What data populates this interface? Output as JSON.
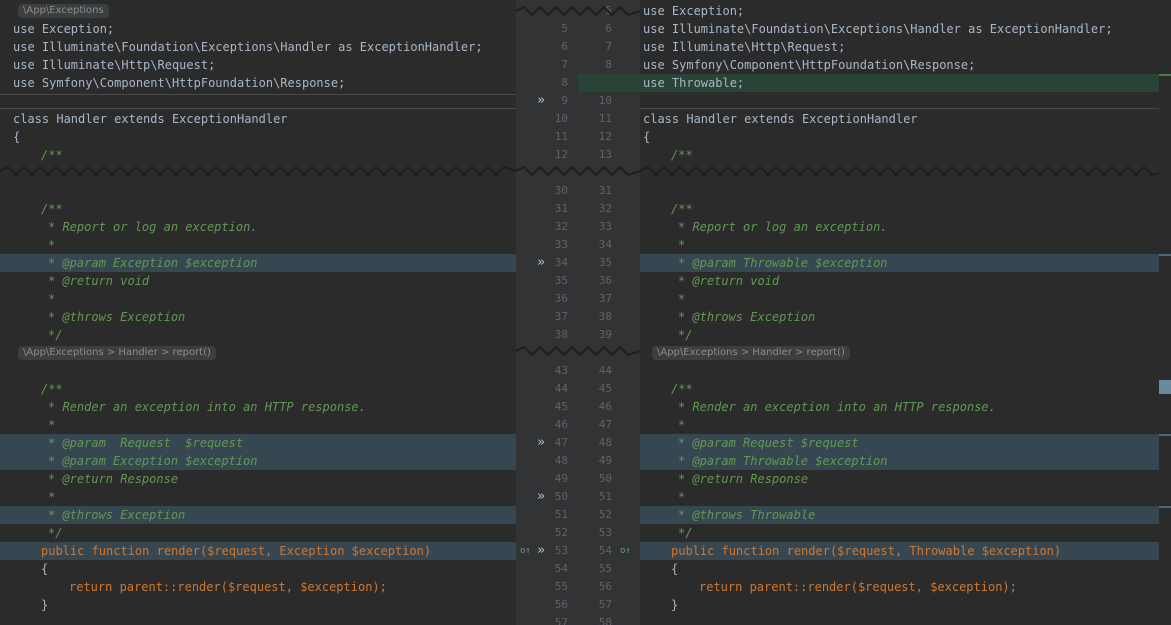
{
  "left": {
    "breadcrumb_top": "\\App\\Exceptions",
    "breadcrumb_mid": "\\App\\Exceptions > Handler > report()",
    "lines": {
      "use1": "use Exception;",
      "use2": "use Illuminate\\Foundation\\Exceptions\\Handler as ExceptionHandler;",
      "use3": "use Illuminate\\Http\\Request;",
      "use4": "use Symfony\\Component\\HttpFoundation\\Response;",
      "cls": "class Handler extends ExceptionHandler",
      "brace": "{",
      "doc1": "/**",
      "doc2": "/**",
      "report": "* Report or log an exception.",
      "star": "*",
      "param1": "* @param Exception $exception",
      "return1": "* @return void",
      "throws1": "* @throws Exception",
      "end": "*/",
      "doc3": "/**",
      "render": "* Render an exception into an HTTP response.",
      "param2": "* @param  Request  $request",
      "param3": "* @param Exception $exception",
      "return2": "* @return Response",
      "throws2": "* @throws Exception",
      "fn": "public function render($request, Exception $exception)",
      "body": "return parent::render($request, $exception);",
      "close": "}"
    }
  },
  "right": {
    "breadcrumb_mid": "\\App\\Exceptions > Handler > report()",
    "lines": {
      "use1": "use Exception;",
      "use2": "use Illuminate\\Foundation\\Exceptions\\Handler as ExceptionHandler;",
      "use3": "use Illuminate\\Http\\Request;",
      "use4": "use Symfony\\Component\\HttpFoundation\\Response;",
      "use5": "use Throwable;",
      "cls": "class Handler extends ExceptionHandler",
      "brace": "{",
      "doc1": "/**",
      "doc2": "/**",
      "report": "* Report or log an exception.",
      "star": "*",
      "param1": "* @param Throwable $exception",
      "return1": "* @return void",
      "throws1": "* @throws Exception",
      "end": "*/",
      "doc3": "/**",
      "render": "* Render an exception into an HTTP response.",
      "param2": "* @param Request $request",
      "param3": "* @param Throwable $exception",
      "return2": "* @return Response",
      "throws2": "* @throws Throwable",
      "fn": "public function render($request, Throwable $exception)",
      "body": "return parent::render($request, $exception);",
      "close": "}"
    }
  },
  "gutter": {
    "rows": [
      [
        "",
        "5"
      ],
      [
        "5",
        "6"
      ],
      [
        "6",
        "7"
      ],
      [
        "7",
        "8"
      ],
      [
        "8",
        "9"
      ],
      [
        "9",
        "10"
      ],
      [
        "10",
        "11"
      ],
      [
        "11",
        "12"
      ],
      [
        "12",
        "13"
      ],
      [
        "30",
        "31"
      ],
      [
        "31",
        "32"
      ],
      [
        "32",
        "33"
      ],
      [
        "33",
        "34"
      ],
      [
        "34",
        "35"
      ],
      [
        "35",
        "36"
      ],
      [
        "36",
        "37"
      ],
      [
        "37",
        "38"
      ],
      [
        "38",
        "39"
      ],
      [
        "43",
        "44"
      ],
      [
        "44",
        "45"
      ],
      [
        "45",
        "46"
      ],
      [
        "46",
        "47"
      ],
      [
        "47",
        "48"
      ],
      [
        "48",
        "49"
      ],
      [
        "49",
        "50"
      ],
      [
        "50",
        "51"
      ],
      [
        "51",
        "52"
      ],
      [
        "52",
        "53"
      ],
      [
        "53",
        "54"
      ],
      [
        "54",
        "55"
      ],
      [
        "55",
        "56"
      ],
      [
        "56",
        "57"
      ],
      [
        "57",
        "58"
      ]
    ],
    "apply_arrow": "»"
  },
  "colors": {
    "background": "#2b2b2b",
    "changed": "#374752",
    "inserted": "#294436",
    "keyword": "#cc7832",
    "variable": "#9876aa",
    "doc_comment": "#629755"
  }
}
